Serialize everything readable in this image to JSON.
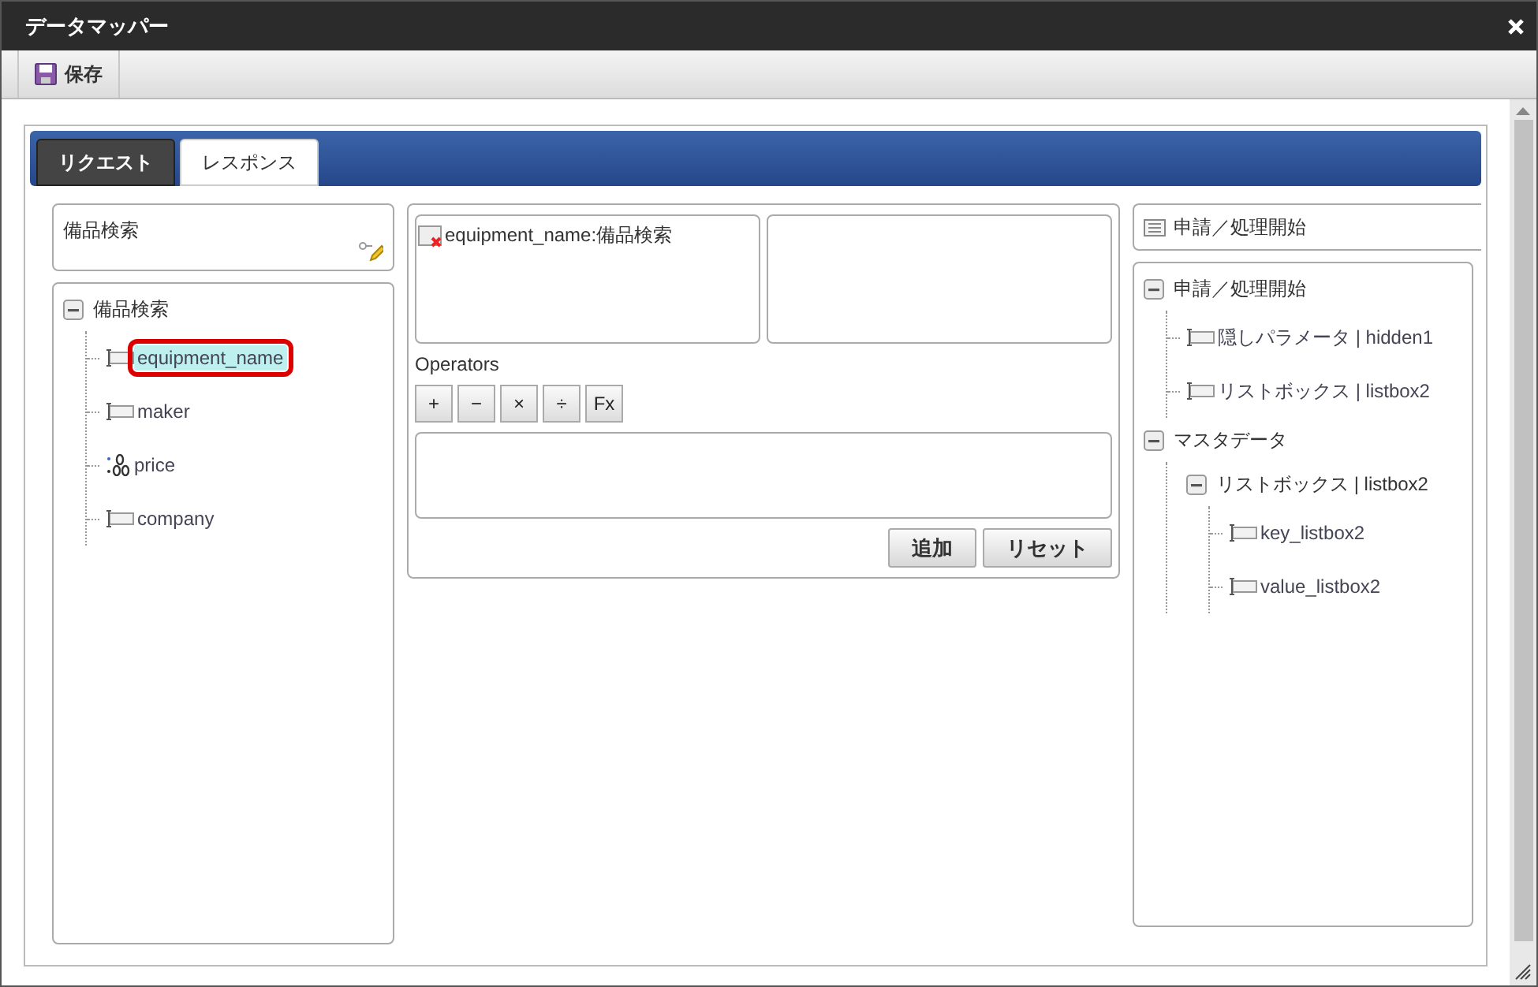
{
  "window": {
    "title": "データマッパー"
  },
  "toolbar": {
    "buttons": [
      {
        "label": "保存"
      }
    ]
  },
  "tabs": [
    {
      "label": "リクエスト",
      "selected": false
    },
    {
      "label": "レスポンス",
      "selected": true
    }
  ],
  "source_panel": {
    "header": "備品検索",
    "tree": [
      {
        "label": "備品検索",
        "expanded": true,
        "children": [
          {
            "label": "equipment_name",
            "kind": "text",
            "selected": true
          },
          {
            "label": "maker",
            "kind": "text",
            "selected": false
          },
          {
            "label": "price",
            "kind": "number",
            "selected": false
          },
          {
            "label": "company",
            "kind": "text",
            "selected": false
          }
        ]
      }
    ]
  },
  "mapping_panel": {
    "mapped_items": [
      {
        "label": "equipment_name:備品検索"
      }
    ],
    "operators_label": "Operators",
    "operators": [
      "+",
      "−",
      "×",
      "÷",
      "Fx"
    ],
    "actions": [
      "追加",
      "リセット"
    ]
  },
  "target_panel": {
    "header": "申請／処理開始",
    "tree": [
      {
        "label": "申請／処理開始",
        "expanded": true,
        "children": [
          {
            "label": "隠しパラメータ | hidden1",
            "kind": "text",
            "selected": false
          },
          {
            "label": "リストボックス | listbox2",
            "kind": "text",
            "selected": false
          }
        ]
      },
      {
        "label": "マスタデータ",
        "expanded": true,
        "children": [
          {
            "label": "リストボックス | listbox2",
            "expanded": true,
            "children": [
              {
                "label": "key_listbox2",
                "kind": "text",
                "selected": false
              },
              {
                "label": "value_listbox2",
                "kind": "text",
                "selected": false
              }
            ]
          }
        ]
      }
    ]
  }
}
